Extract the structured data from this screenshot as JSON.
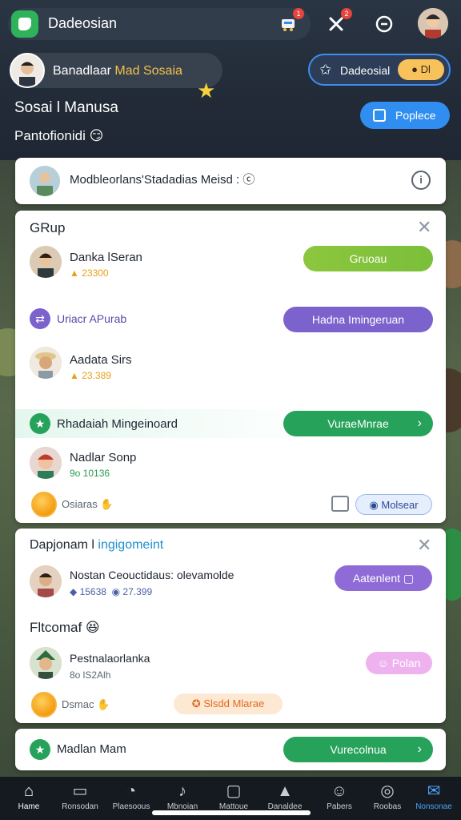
{
  "app": {
    "title": "Dadeosian",
    "icons": [
      "app-logo-icon",
      "cart-icon",
      "tools-icon",
      "compass-icon"
    ],
    "cart_badge": "1",
    "tools_badge": "2"
  },
  "user": {
    "name_part1": "Banadlaar",
    "name_part2": "Mad Sosaia"
  },
  "right_pill": {
    "label": "Dadeosial",
    "chip": "Dl"
  },
  "section": {
    "title": "Sosai l Manusa",
    "subtitle": "Pantofionidi",
    "subtitle_emoji": "😏",
    "button": "Poplece"
  },
  "card1": {
    "text": "Modbleorlans'Stadadias Meisd : ⓒ"
  },
  "group": {
    "title": "GRup",
    "members": [
      {
        "name": "Danka lSeran",
        "meta": "23300",
        "button": "Gruoau"
      },
      {
        "name": "Aadata Sirs",
        "meta": "23.389"
      },
      {
        "name": "Nadlar Sonp",
        "meta": "9o 10136"
      }
    ],
    "row_link": "Uriacr APurab",
    "row_link_button": "Hadna Imingeruan",
    "reward_row": "Rhadaiah Mingeinoard",
    "reward_button": "VuraeMnrae",
    "coin_label": "Osiaras",
    "footer_button": "Molsear"
  },
  "card3": {
    "title_part1": "Dapjonam l",
    "title_part2": "ingigomeint",
    "member": {
      "name": "Nostan Ceouctidaus: olevamolde",
      "meta1": "15638",
      "meta2": "27.399",
      "button": "Aatenlent"
    },
    "subheading": "Fltcomaf",
    "subheading_emoji": "😆",
    "member2": {
      "name": "Pestnalaorlanka",
      "meta": "8o lS2Alh",
      "button": "Polan"
    },
    "coin_label": "Dsmac",
    "orange_pill": "Slsdd Mlarae"
  },
  "card4": {
    "label": "Madlan Mam",
    "button": "Vurecolnua"
  },
  "nav": [
    {
      "label": "Hame",
      "icon": "home-icon"
    },
    {
      "label": "Ronsodan",
      "icon": "chart-icon"
    },
    {
      "label": "Plaesoous",
      "icon": "clock-icon"
    },
    {
      "label": "Mbnoian",
      "icon": "note-icon"
    },
    {
      "label": "Mattoue",
      "icon": "window-icon"
    },
    {
      "label": "Danaldee",
      "icon": "triangle-icon"
    },
    {
      "label": "Pabers",
      "icon": "chat-icon"
    },
    {
      "label": "Roobas",
      "icon": "compass-icon"
    },
    {
      "label": "Nonsonae",
      "icon": "bell-icon"
    }
  ],
  "colors": {
    "accent_blue": "#2f8ef0",
    "green": "#27a25a",
    "purple": "#7c62cc",
    "lime": "#8cc63e"
  }
}
